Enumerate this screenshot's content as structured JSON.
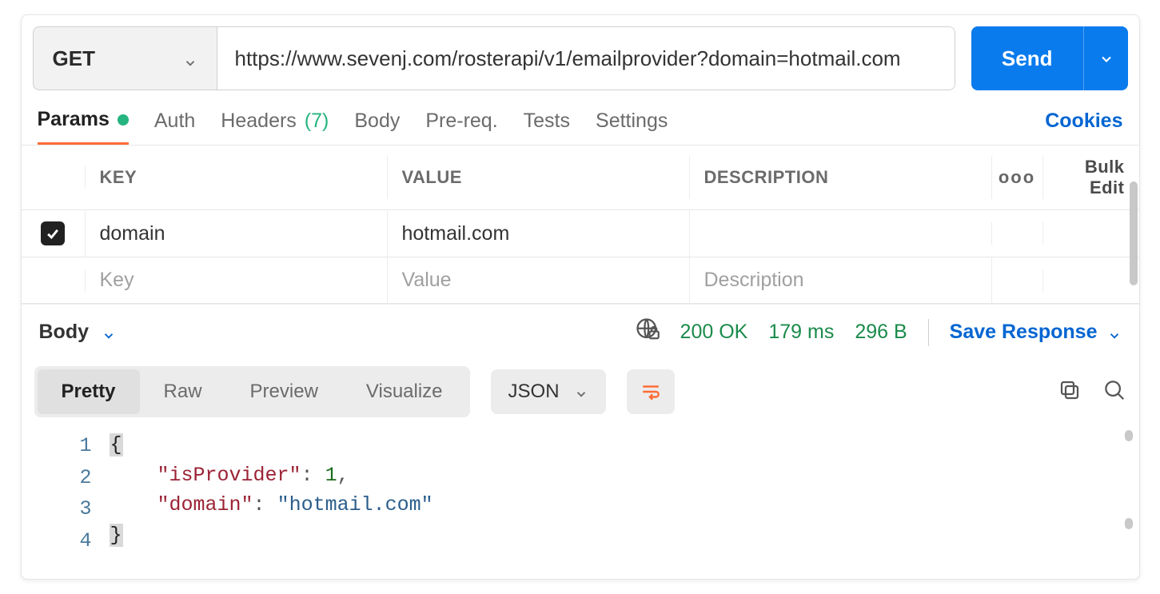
{
  "request": {
    "method": "GET",
    "url": "https://www.sevenj.com/rosterapi/v1/emailprovider?domain=hotmail.com",
    "send_label": "Send"
  },
  "tabs": {
    "params": "Params",
    "auth": "Auth",
    "headers_label": "Headers",
    "headers_count": "(7)",
    "body": "Body",
    "prereq": "Pre-req.",
    "tests": "Tests",
    "settings": "Settings",
    "cookies": "Cookies"
  },
  "params_table": {
    "header_key": "KEY",
    "header_value": "VALUE",
    "header_desc": "DESCRIPTION",
    "bulk_edit": "Bulk Edit",
    "rows": [
      {
        "checked": true,
        "key": "domain",
        "value": "hotmail.com",
        "desc": ""
      }
    ],
    "placeholder_key": "Key",
    "placeholder_value": "Value",
    "placeholder_desc": "Description"
  },
  "response": {
    "body_label": "Body",
    "status_code": "200",
    "status_text": "OK",
    "time": "179 ms",
    "size": "296 B",
    "save_label": "Save Response"
  },
  "view": {
    "tabs": [
      "Pretty",
      "Raw",
      "Preview",
      "Visualize"
    ],
    "active": "Pretty",
    "language": "JSON"
  },
  "json_body": {
    "line_numbers": [
      "1",
      "2",
      "3",
      "4"
    ],
    "key1": "\"isProvider\"",
    "val1": "1",
    "key2": "\"domain\"",
    "val2": "\"hotmail.com\""
  }
}
